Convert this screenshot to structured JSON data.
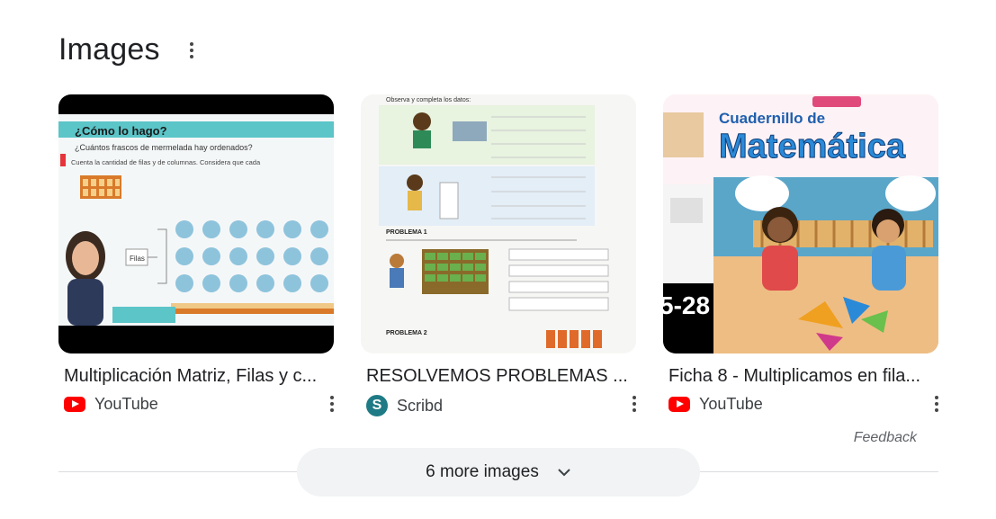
{
  "section": {
    "title": "Images"
  },
  "cards": [
    {
      "title": "Multiplicación Matriz, Filas y c...",
      "source": "YouTube",
      "source_icon": "youtube-icon",
      "thumb_text": {
        "heading": "¿Cómo lo hago?",
        "question": "¿Cuántos frascos de mermelada hay ordenados?",
        "instruction": "Cuenta la cantidad de filas y de columnas. Considera que cada",
        "box_label": "Filas"
      }
    },
    {
      "title": "RESOLVEMOS PROBLEMAS ...",
      "source": "Scribd",
      "source_icon": "scribd-icon",
      "thumb_text": {
        "top": "Observa y completa los datos:",
        "problem1": "PROBLEMA 1",
        "problem2": "PROBLEMA 2"
      }
    },
    {
      "title": "Ficha 8 - Multiplicamos en fila...",
      "source": "YouTube",
      "source_icon": "youtube-icon",
      "thumb_text": {
        "line1": "Cuadernillo de",
        "line2": "Matemática",
        "badge": "5-28"
      }
    }
  ],
  "feedback": "Feedback",
  "more_button": {
    "label": "6 more images"
  },
  "colors": {
    "accent_red": "#ff0000",
    "scribd_teal": "#1e7b85",
    "button_bg": "#f1f3f4"
  }
}
